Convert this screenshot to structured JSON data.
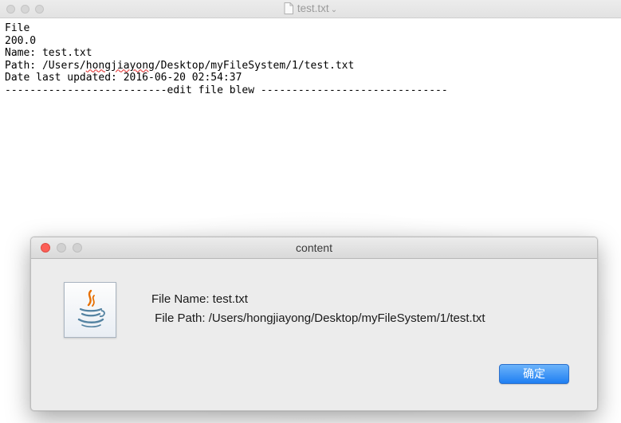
{
  "editor": {
    "title": "test.txt",
    "lines": {
      "l1": "File",
      "l2": "200.0",
      "l3": "Name: test.txt",
      "l4_prefix": "Path: /Users/",
      "l4_misspelled": "hongjiayong",
      "l4_suffix": "/Desktop/myFileSystem/1/test.txt",
      "l5": "Date last updated: 2016-06-20 02:54:37",
      "l6": "--------------------------edit file blew ------------------------------"
    }
  },
  "dialog": {
    "title": "content",
    "icon": "java-coffee-icon",
    "file_name_line": "File Name: test.txt",
    "file_path_line": " File Path: /Users/hongjiayong/Desktop/myFileSystem/1/test.txt",
    "ok_label": "确定",
    "colors": {
      "close": "#fc5f57",
      "ok": "#1f7ff2"
    }
  }
}
